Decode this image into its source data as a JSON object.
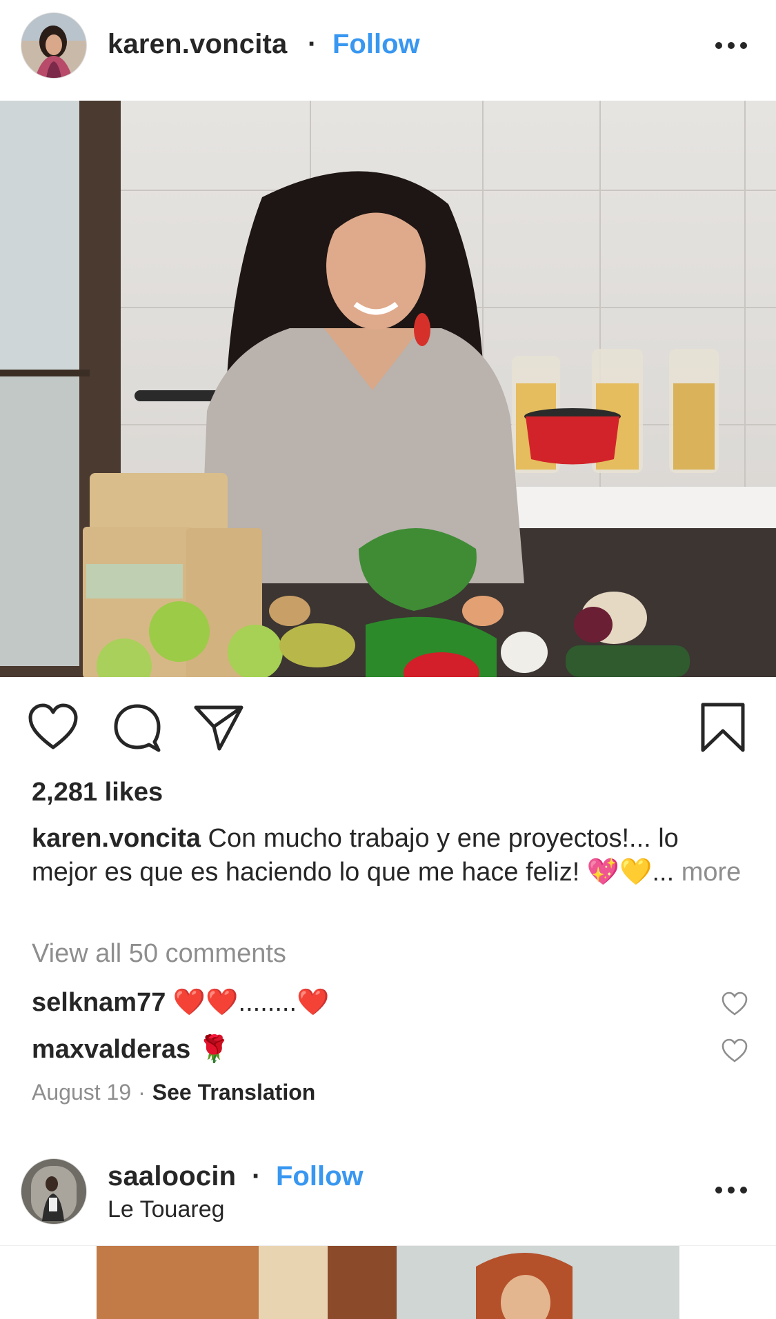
{
  "post1": {
    "username": "karen.voncita",
    "separator": "·",
    "follow_label": "Follow",
    "likes": "2,281 likes",
    "caption": {
      "username": "karen.voncita",
      "text": " Con mucho trabajo y ene proyectos!... lo mejor es que es haciendo lo que me hace feliz! 💖💛",
      "more_prefix": "... ",
      "more_label": "more"
    },
    "view_comments": "View all 50 comments",
    "comments": [
      {
        "user": "selknam77",
        "text": " ❤️❤️........❤️"
      },
      {
        "user": "maxvalderas",
        "text": " 🌹"
      }
    ],
    "date": "August 19",
    "meta_separator": "·",
    "see_translation": "See Translation"
  },
  "post2": {
    "username": "saaloocin",
    "separator": "·",
    "follow_label": "Follow",
    "location": "Le Touareg"
  },
  "icons": {
    "like": "heart-icon",
    "comment": "comment-icon",
    "share": "paper-plane-icon",
    "save": "bookmark-icon",
    "more": "more-dots-icon"
  },
  "colors": {
    "link_blue": "#3897f0",
    "text": "#262626",
    "muted": "#8e8e8e"
  }
}
